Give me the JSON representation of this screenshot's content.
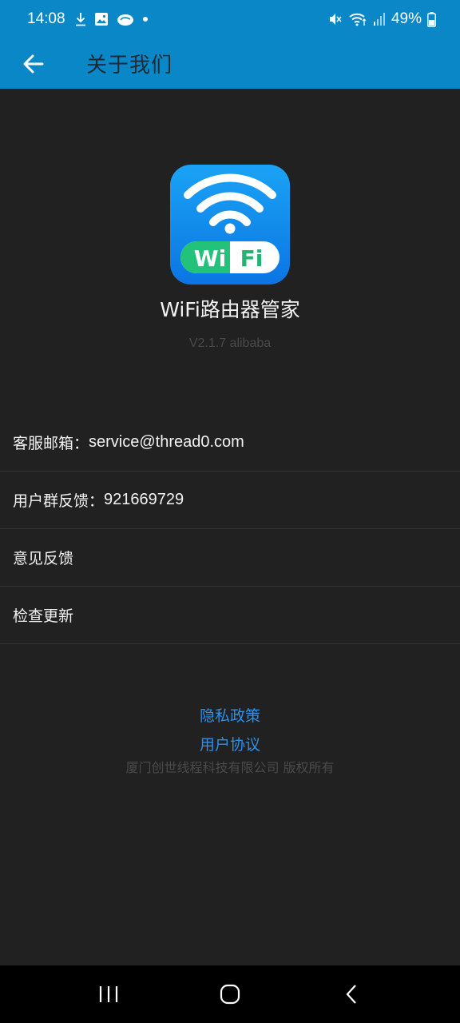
{
  "status_bar": {
    "time": "14:08",
    "battery": "49%",
    "icons": [
      "download-icon",
      "image-icon",
      "cloud-icon",
      "dot-icon",
      "mute-icon",
      "wifi-icon",
      "signal-icon",
      "battery-icon"
    ]
  },
  "app_bar": {
    "title": "关于我们",
    "back_icon": "arrow-left-icon"
  },
  "app_info": {
    "name": "WiFi路由器管家",
    "version": "V2.1.7 alibaba",
    "logo_text_left": "Wi",
    "logo_text_right": "Fi"
  },
  "list": {
    "items": [
      {
        "label": "客服邮箱：",
        "value": "service@thread0.com"
      },
      {
        "label": "用户群反馈：",
        "value": "921669729"
      },
      {
        "label": "意见反馈",
        "value": ""
      },
      {
        "label": "检查更新",
        "value": ""
      }
    ]
  },
  "footer": {
    "privacy_policy": "隐私政策",
    "user_agreement": "用户协议",
    "copyright": "厦门创世线程科技有限公司 版权所有"
  },
  "colors": {
    "accent": "#0a87c6",
    "background": "#212121",
    "link": "#2f8fe6"
  }
}
